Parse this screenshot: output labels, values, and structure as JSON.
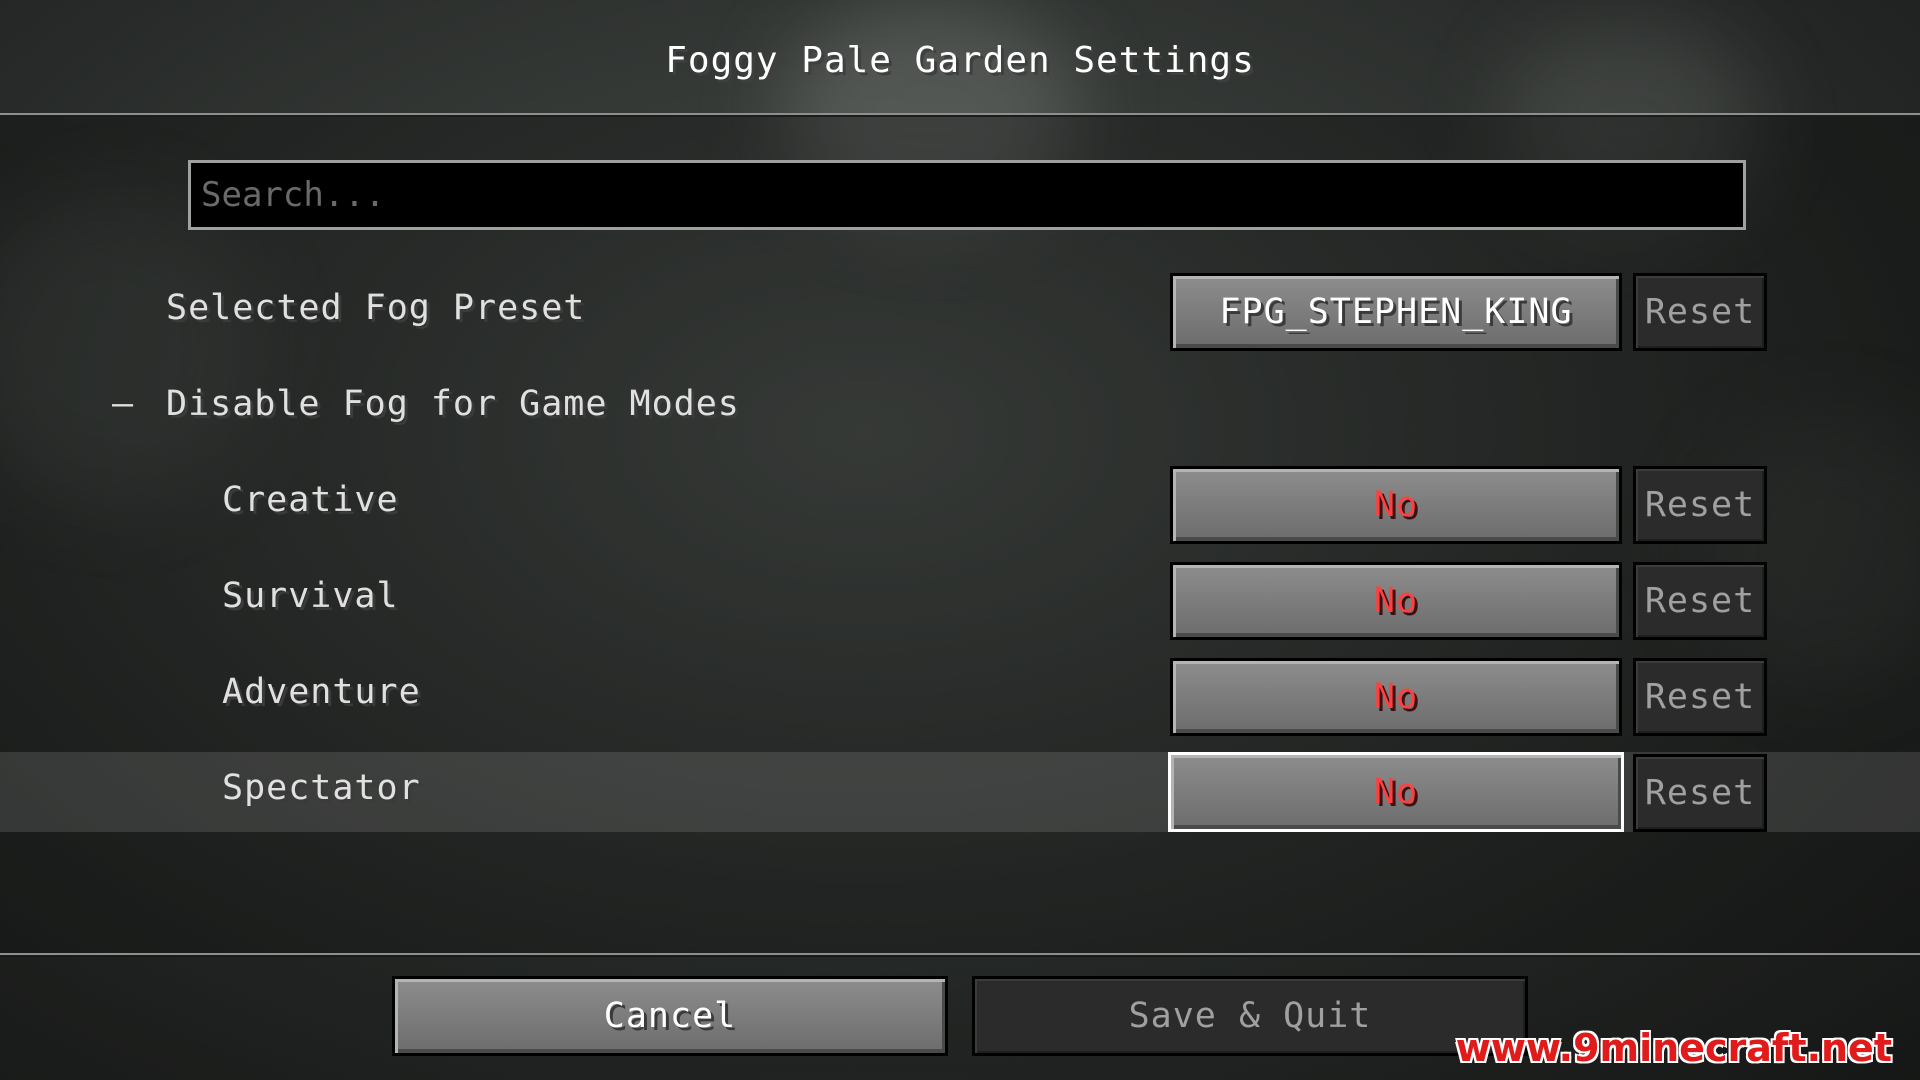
{
  "screen": {
    "title": "Foggy Pale Garden Settings"
  },
  "search": {
    "placeholder": "Search..."
  },
  "preset": {
    "label": "Selected Fog Preset",
    "value": "FPG_STEPHEN_KING",
    "reset_label": "Reset"
  },
  "group": {
    "toggle_symbol": "–",
    "label": "Disable Fog for Game Modes"
  },
  "modes": [
    {
      "label": "Creative",
      "value": "No",
      "reset_label": "Reset"
    },
    {
      "label": "Survival",
      "value": "No",
      "reset_label": "Reset"
    },
    {
      "label": "Adventure",
      "value": "No",
      "reset_label": "Reset"
    },
    {
      "label": "Spectator",
      "value": "No",
      "reset_label": "Reset"
    }
  ],
  "footer": {
    "cancel_label": "Cancel",
    "save_label": "Save & Quit"
  },
  "watermark": {
    "text": "www.9minecraft.net"
  },
  "colors": {
    "value_no": "#ff4040",
    "watermark": "#e01b1b",
    "focus_outline": "#ffffff"
  }
}
